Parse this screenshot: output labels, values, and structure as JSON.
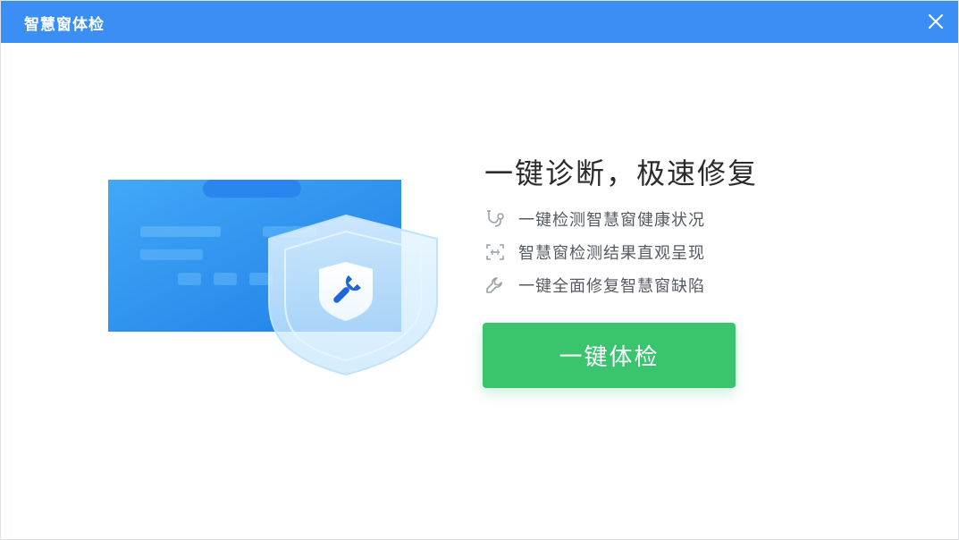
{
  "window": {
    "title": "智慧窗体检"
  },
  "main": {
    "headline": "一键诊断，极速修复",
    "features": [
      {
        "icon": "stethoscope-icon",
        "label": "一键检测智慧窗健康状况"
      },
      {
        "icon": "scan-icon",
        "label": "智慧窗检测结果直观呈现"
      },
      {
        "icon": "wrench-icon",
        "label": "一键全面修复智慧窗缺陷"
      }
    ],
    "check_button_label": "一键体检"
  },
  "colors": {
    "titlebar": "#3b8ef3",
    "button": "#3bc46e",
    "screen": "#2e97f1",
    "shield": "#d9efff"
  },
  "icons": {
    "close": "close-icon",
    "illustration": "monitor-shield-wrench-illustration"
  }
}
